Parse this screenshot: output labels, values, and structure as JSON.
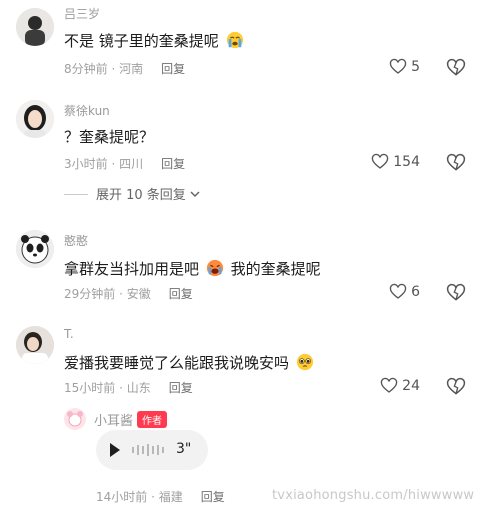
{
  "comments": [
    {
      "username": "吕三岁",
      "text": "不是 镜子里的奎桑提呢",
      "emoji": "crying-emoji",
      "time": "8分钟前",
      "location": "河南",
      "reply_label": "回复",
      "likes": "5"
    },
    {
      "username": "蔡徐kun",
      "text": "？奎桑提呢？",
      "time": "3小时前",
      "location": "四川",
      "reply_label": "回复",
      "likes": "154",
      "expand_label": "展开 10 条回复"
    },
    {
      "username": "憨憨",
      "text_before": "拿群友当抖加用是吧",
      "emoji": "crying-face-emoji",
      "text_after": "我的奎桑提呢",
      "time": "29分钟前",
      "location": "安徽",
      "reply_label": "回复",
      "likes": "6"
    },
    {
      "username": "T.",
      "text": "爱播我要睡觉了么能跟我说晚安吗",
      "emoji": "pleading-emoji",
      "time": "15小时前",
      "location": "山东",
      "reply_label": "回复",
      "likes": "24"
    }
  ],
  "author_reply": {
    "username": "小耳酱",
    "badge": "作者",
    "voice_duration": "3\"",
    "time": "14小时前",
    "location": "福建",
    "reply_label": "回复"
  },
  "separator": " · ",
  "watermark": "tvxiaohongshu.com/hiwwwww",
  "colors": {
    "badge": "#ff3b4f",
    "meta": "#9f9f9f"
  }
}
